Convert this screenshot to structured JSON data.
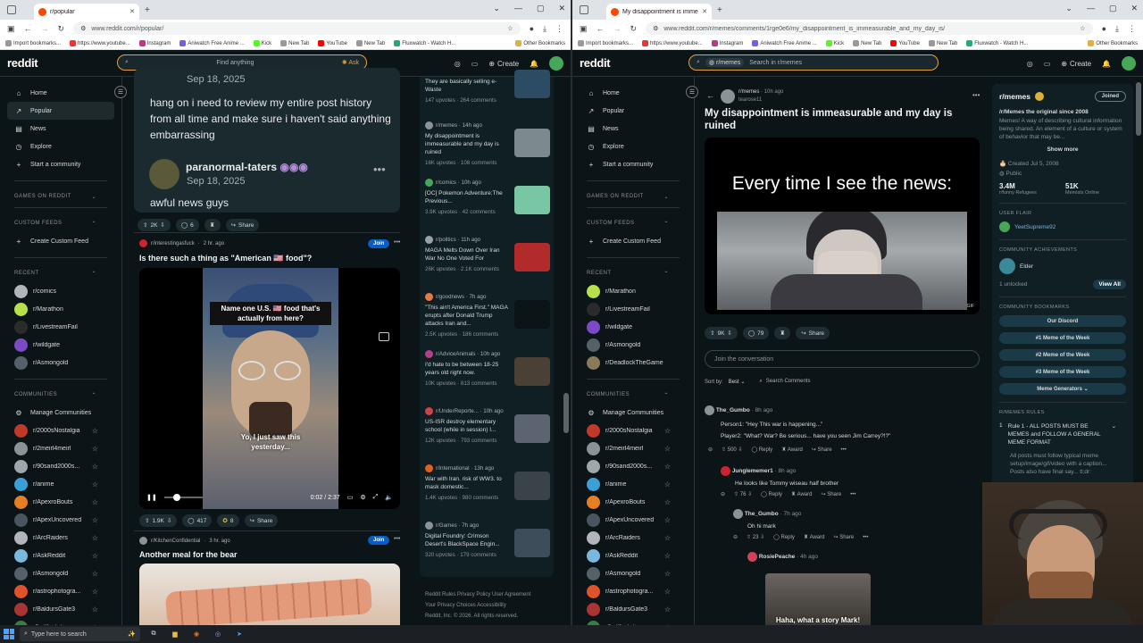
{
  "left": {
    "tab_title": "r/popular",
    "url": "www.reddit.com/r/popular/",
    "search_placeholder": "Find anything",
    "ask_label": "Ask",
    "comment1_text": "hang on i need to review my entire post history from all time and make sure i haven't said anything embarrassing",
    "comment1_date": "Sep 18, 2025",
    "comment2_user": "paranormal-taters",
    "comment2_date": "Sep 18, 2025",
    "comment2_text": "awful news guys",
    "card1_votes": "2K",
    "card1_comments": "6",
    "share_label": "Share",
    "post1": {
      "subreddit": "r/interestingasfuck",
      "age": "2 hr. ago",
      "join": "Join",
      "title": "Is there such a thing as \"American 🇺🇸 food\"?",
      "caption_top": "Name one U.S. 🇺🇸 food that's actually from here?",
      "caption_bottom": "Yo, I just saw this yesterday...",
      "time": "0:02 / 2:37",
      "votes": "1.9K",
      "comments": "417",
      "awards": "8"
    },
    "post2": {
      "subreddit": "r/KitchenConfidential",
      "age": "3 hr. ago",
      "join": "Join",
      "title": "Another meal for the bear"
    },
    "rail": [
      {
        "sub": "",
        "title": "They are basically selling e-Waste",
        "meta": "147 upvotes · 264 comments",
        "color": "#6a7479",
        "thumb": "#2b4c63"
      },
      {
        "sub": "r/memes · 14h ago",
        "title": "My disappointment is immeasurable and my day is ruined",
        "meta": "16K upvotes · 108 comments",
        "color": "#8a9396",
        "thumb": "#7c8a8f"
      },
      {
        "sub": "r/comics · 10h ago",
        "title": "[OC] Pokemon Adventure:The Previous...",
        "meta": "3.9K upvotes · 42 comments",
        "color": "#46a758",
        "thumb": "#79c6a3"
      },
      {
        "sub": "r/politics · 11h ago",
        "title": "MAGA Melts Down Over Iran War No One Voted For",
        "meta": "26K upvotes · 2.1K comments",
        "color": "#9aa2a5",
        "thumb": "#b22a2a"
      },
      {
        "sub": "r/goodnews · 7h ago",
        "title": "\"This ain't America First.\" MAGA erupts after Donald Trump attacks Iran and...",
        "meta": "2.5K upvotes · 186 comments",
        "color": "#e57a45",
        "thumb": "#0b1416"
      },
      {
        "sub": "r/AdviceAnimals · 10h ago",
        "title": "I'd hate to be between 18-25 years old right now.",
        "meta": "10K upvotes · 813 comments",
        "color": "#b0408a",
        "thumb": "#4a4035"
      },
      {
        "sub": "r/UnderReporte... · 10h ago",
        "title": "US-ISR destroy elementary school (while in session) I...",
        "meta": "12K upvotes · 793 comments",
        "color": "#c44",
        "thumb": "#5b6470"
      },
      {
        "sub": "r/international · 13h ago",
        "title": "War with Iran. risk of WW3. to mask domestic...",
        "meta": "1.4K upvotes · 980 comments",
        "color": "#e06020",
        "thumb": "#3a4448"
      },
      {
        "sub": "r/Games · 7h ago",
        "title": "Digital Foundry: Crimson Desert's BlackSpace Engin...",
        "meta": "320 upvotes · 179 comments",
        "color": "#8a9396",
        "thumb": "#3d4e5a"
      }
    ],
    "footer1": "Reddit Rules  Privacy Policy  User Agreement",
    "footer2": "Your Privacy Choices  Accessibility",
    "footer3": "Reddit, Inc. © 2026. All rights reserved."
  },
  "right": {
    "tab_title": "My disappointment is immeasura...",
    "url": "www.reddit.com/r/memes/comments/1rge0e6/my_disappointment_is_immeasurable_and_my_day_is/",
    "search_chip": "r/memes",
    "search_placeholder": "Search in r/memes",
    "post": {
      "subreddit": "r/memes",
      "age": "10h ago",
      "user": "tearose11",
      "title": "My disappointment is immeasurable and my day is ruined",
      "meme_text": "Every time I see the news:",
      "gif": "GIF",
      "votes": "9K",
      "comments": "79",
      "share": "Share",
      "join_placeholder": "Join the conversation",
      "sort_label": "Sort by:",
      "sort_value": "Best",
      "search_comments": "Search Comments"
    },
    "comments": [
      {
        "user": "The_Gumbo",
        "age": "8h ago",
        "lines": [
          "Person1: \"Hey This war is happening...\"",
          "Player2: \"What? War? Be serious... have you seen Jim Carrey?!?\""
        ],
        "votes": "500"
      },
      {
        "user": "Junglememer1",
        "age": "8h ago",
        "lines": [
          "He looks like Tommy wiseau half brother"
        ],
        "votes": "76"
      },
      {
        "user": "The_Gumbo",
        "age": "7h ago",
        "lines": [
          "Oh hi mark"
        ],
        "votes": "23"
      },
      {
        "user": "RosiePeache",
        "age": "4h ago",
        "lines": [
          "Haha, what a story Mark!"
        ],
        "votes": ""
      }
    ],
    "reply": "Reply",
    "award": "Award",
    "share": "Share",
    "sidebar": {
      "name": "r/memes",
      "joined": "Joined",
      "tagline": "/r/Memes the original since 2008",
      "description": "Memes! A way of describing cultural information being shared. An element of a culture or system of behavior that may be...",
      "show_more": "Show more",
      "created": "Created Jul 5, 2008",
      "visibility": "Public",
      "members": "3.4M",
      "members_label": "r/funny Refugees",
      "online": "51K",
      "online_label": "Memists Online",
      "user_flair_head": "USER FLAIR",
      "flair_name": "YeetSupreme92",
      "achievements_head": "COMMUNITY ACHIEVEMENTS",
      "achievement": "Elder",
      "unlocked": "1 unlocked",
      "view_all": "View All",
      "bookmarks_head": "COMMUNITY BOOKMARKS",
      "bookmarks": [
        "Our Discord",
        "#1 Meme of the Week",
        "#2 Meme of the Week",
        "#3 Meme of the Week",
        "Meme Generators ⌄"
      ],
      "rules_head": "R/MEMES RULES",
      "rule1": "Rule 1 - ALL POSTS MUST BE MEMES and FOLLOW A GENERAL MEME FORMAT",
      "rule1_detail": "All posts must follow typical meme setup/image/gif/video with a caption... Posts also have final say... tl;dr:"
    }
  },
  "shared": {
    "logo": "reddit",
    "create": "Create",
    "nav": [
      "Home",
      "Popular",
      "News",
      "Explore",
      "Start a community"
    ],
    "games_head": "GAMES ON REDDIT",
    "custom_feeds_head": "CUSTOM FEEDS",
    "create_custom_feed": "Create Custom Feed",
    "recent_head": "RECENT",
    "communities_head": "COMMUNITIES",
    "manage_communities": "Manage Communities",
    "bookmarks": [
      "Import bookmarks...",
      "https://www.youtube...",
      "Instagram",
      "Aniwatch Free Anime ...",
      "Kick",
      "New Tab",
      "YouTube",
      "New Tab",
      "Fluxwatch - Watch H..."
    ],
    "other_bookmarks": "Other Bookmarks",
    "communities": [
      {
        "name": "r/2000sNostalgia",
        "color": "#c0392b"
      },
      {
        "name": "r/2meirl4meirl",
        "color": "#8a9396"
      },
      {
        "name": "r/90sand2000s...",
        "color": "#a0a7aa"
      },
      {
        "name": "r/anime",
        "color": "#3aa0d8"
      },
      {
        "name": "r/ApexroBouts",
        "color": "#e67e22"
      },
      {
        "name": "r/ApexUncovered",
        "color": "#4b5560"
      },
      {
        "name": "r/ArcRaiders",
        "color": "#b0b6b9"
      },
      {
        "name": "r/AskReddit",
        "color": "#7ab8e0"
      },
      {
        "name": "r/Asmongold",
        "color": "#55606a"
      },
      {
        "name": "r/astrophotogra...",
        "color": "#e0522b"
      },
      {
        "name": "r/BaldursGate3",
        "color": "#a33"
      },
      {
        "name": "r/battlestations",
        "color": "#3a7d44"
      }
    ]
  },
  "left_recent": [
    {
      "name": "r/comics",
      "color": "#b0b6b9"
    },
    {
      "name": "r/Marathon",
      "color": "#b7e04a"
    },
    {
      "name": "r/LivestreamFail",
      "color": "#2b2b2b"
    },
    {
      "name": "r/wildgate",
      "color": "#7a4ac7"
    },
    {
      "name": "r/Asmongold",
      "color": "#55606a"
    }
  ],
  "right_recent": [
    {
      "name": "r/Marathon",
      "color": "#b7e04a"
    },
    {
      "name": "r/LivestreamFail",
      "color": "#2b2b2b"
    },
    {
      "name": "r/wildgate",
      "color": "#7a4ac7"
    },
    {
      "name": "r/Asmongold",
      "color": "#55606a"
    },
    {
      "name": "r/DeadlockTheGame",
      "color": "#8a7a5a"
    }
  ],
  "taskbar": {
    "search_placeholder": "Type here to search"
  }
}
